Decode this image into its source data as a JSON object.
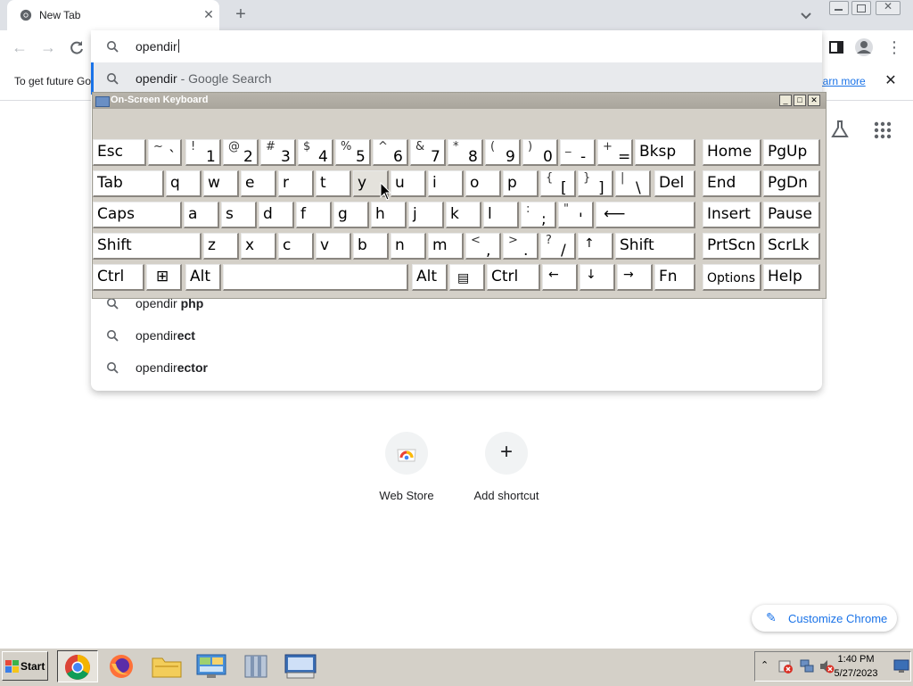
{
  "browser": {
    "tab_title": "New Tab",
    "tab_close": "✕",
    "new_tab": "+",
    "omnibox_text": "opendir"
  },
  "suggestions": [
    {
      "prefix": "opendir",
      "suffix": "",
      "desc": " - Google Search"
    },
    {
      "prefix": "opendir",
      "suffix": " php",
      "desc": ""
    },
    {
      "prefix": "opendir",
      "suffix": "ect",
      "desc": ""
    },
    {
      "prefix": "opendir",
      "suffix": "ector",
      "desc": ""
    }
  ],
  "infobar": {
    "text": "To get future Go",
    "link": "earn more",
    "close": "✕"
  },
  "ntp": {
    "shortcuts": [
      {
        "label": "Web Store"
      },
      {
        "label": "Add shortcut"
      }
    ],
    "customize_label": "Customize Chrome"
  },
  "osk": {
    "title": "On-Screen Keyboard",
    "row1": [
      "Esc",
      "~`",
      "!1",
      "@2",
      "#3",
      "$4",
      "%5",
      "^6",
      "&7",
      "*8",
      "(9",
      ")0",
      "_-",
      "+=",
      "Bksp",
      "Home",
      "PgUp"
    ],
    "row2": [
      "Tab",
      "q",
      "w",
      "e",
      "r",
      "t",
      "y",
      "u",
      "i",
      "o",
      "p",
      "{[",
      "}]",
      "|\\",
      "Del",
      "End",
      "PgDn"
    ],
    "row3": [
      "Caps",
      "a",
      "s",
      "d",
      "f",
      "g",
      "h",
      "j",
      "k",
      "l",
      ":;",
      "\"'",
      "Enter",
      "Insert",
      "Pause"
    ],
    "row4": [
      "Shift",
      "z",
      "x",
      "c",
      "v",
      "b",
      "n",
      "m",
      "<,",
      ">.",
      "?/",
      "↑",
      "Shift",
      "PrtScn",
      "ScrLk"
    ],
    "row5": [
      "Ctrl",
      "Win",
      "Alt",
      "Space",
      "Alt",
      "Menu",
      "Ctrl",
      "←",
      "↓",
      "→",
      "Fn",
      "Options",
      "Help"
    ]
  },
  "taskbar": {
    "start_label": "Start",
    "time": "1:40 PM",
    "date": "5/27/2023",
    "apps": [
      "chrome-icon",
      "firefox-icon",
      "folder-icon",
      "control-panel-icon",
      "archive-icon",
      "on-screen-keyboard-icon"
    ]
  },
  "colors": {
    "accent": "#1a73e8",
    "osk_bg": "#d4d0c8"
  }
}
